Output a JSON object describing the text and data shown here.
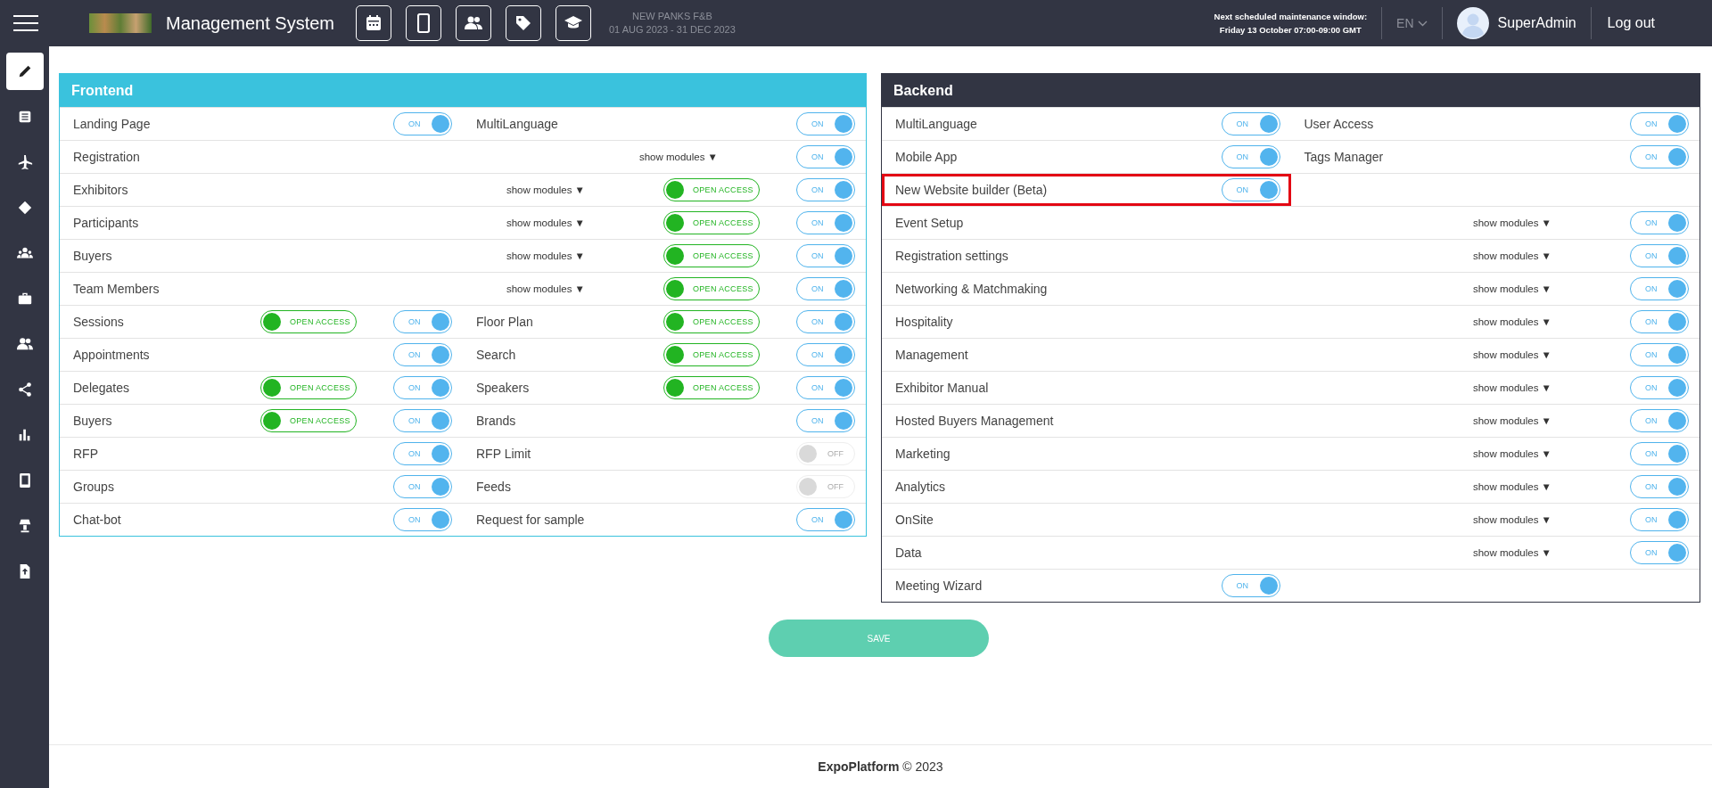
{
  "header": {
    "title": "Management System",
    "event_name": "NEW PANKS F&B",
    "event_dates": "01 AUG 2023 - 31 DEC 2023",
    "maintenance_title": "Next scheduled maintenance window:",
    "maintenance_time": "Friday 13 October 07:00-09:00 GMT",
    "language": "EN",
    "user": "SuperAdmin",
    "logout": "Log out"
  },
  "sidebar": {
    "items": [
      {
        "selected": true
      },
      {
        "selected": false
      },
      {
        "selected": false
      },
      {
        "selected": false
      },
      {
        "selected": false
      },
      {
        "selected": false
      },
      {
        "selected": false
      },
      {
        "selected": false
      },
      {
        "selected": false
      },
      {
        "selected": false
      },
      {
        "selected": false
      },
      {
        "selected": false
      }
    ]
  },
  "frontend": {
    "title": "Frontend",
    "rows": [
      {
        "kind": "split",
        "cells": [
          {
            "label": "Landing Page",
            "toggle": {
              "label": "ON",
              "on": true
            }
          },
          {
            "label": "MultiLanguage",
            "toggle": {
              "label": "ON",
              "on": true
            }
          }
        ]
      },
      {
        "kind": "full",
        "cells": [
          {
            "label": "Registration",
            "show_modules": "show modules ▼",
            "toggle": {
              "label": "ON",
              "on": true
            }
          }
        ]
      },
      {
        "kind": "full",
        "cells": [
          {
            "label": "Exhibitors",
            "show_modules": "show modules ▼",
            "open_access": {
              "label": "OPEN ACCESS",
              "on": true
            },
            "toggle": {
              "label": "ON",
              "on": true
            }
          }
        ]
      },
      {
        "kind": "full",
        "cells": [
          {
            "label": "Participants",
            "show_modules": "show modules ▼",
            "open_access": {
              "label": "OPEN ACCESS",
              "on": true
            },
            "toggle": {
              "label": "ON",
              "on": true
            }
          }
        ]
      },
      {
        "kind": "full",
        "cells": [
          {
            "label": "Buyers",
            "show_modules": "show modules ▼",
            "open_access": {
              "label": "OPEN ACCESS",
              "on": true
            },
            "toggle": {
              "label": "ON",
              "on": true
            }
          }
        ]
      },
      {
        "kind": "full",
        "cells": [
          {
            "label": "Team Members",
            "show_modules": "show modules ▼",
            "open_access": {
              "label": "OPEN ACCESS",
              "on": true
            },
            "toggle": {
              "label": "ON",
              "on": true
            }
          }
        ]
      },
      {
        "kind": "split",
        "cells": [
          {
            "label": "Sessions",
            "open_access": {
              "label": "OPEN ACCESS",
              "on": true
            },
            "toggle": {
              "label": "ON",
              "on": true
            }
          },
          {
            "label": "Floor Plan",
            "open_access": {
              "label": "OPEN ACCESS",
              "on": true
            },
            "toggle": {
              "label": "ON",
              "on": true
            }
          }
        ]
      },
      {
        "kind": "split",
        "cells": [
          {
            "label": "Appointments",
            "toggle": {
              "label": "ON",
              "on": true
            }
          },
          {
            "label": "Search",
            "open_access": {
              "label": "OPEN ACCESS",
              "on": true
            },
            "toggle": {
              "label": "ON",
              "on": true
            }
          }
        ]
      },
      {
        "kind": "split",
        "cells": [
          {
            "label": "Delegates",
            "open_access": {
              "label": "OPEN ACCESS",
              "on": true
            },
            "toggle": {
              "label": "ON",
              "on": true
            }
          },
          {
            "label": "Speakers",
            "open_access": {
              "label": "OPEN ACCESS",
              "on": true
            },
            "toggle": {
              "label": "ON",
              "on": true
            }
          }
        ]
      },
      {
        "kind": "split",
        "cells": [
          {
            "label": "Buyers",
            "open_access": {
              "label": "OPEN ACCESS",
              "on": true
            },
            "toggle": {
              "label": "ON",
              "on": true
            }
          },
          {
            "label": "Brands",
            "toggle": {
              "label": "ON",
              "on": true
            }
          }
        ]
      },
      {
        "kind": "split",
        "cells": [
          {
            "label": "RFP",
            "toggle": {
              "label": "ON",
              "on": true
            }
          },
          {
            "label": "RFP Limit",
            "toggle": {
              "label": "OFF",
              "on": false
            }
          }
        ]
      },
      {
        "kind": "split",
        "cells": [
          {
            "label": "Groups",
            "toggle": {
              "label": "ON",
              "on": true
            }
          },
          {
            "label": "Feeds",
            "toggle": {
              "label": "OFF",
              "on": false
            }
          }
        ]
      },
      {
        "kind": "split",
        "cells": [
          {
            "label": "Chat-bot",
            "toggle": {
              "label": "ON",
              "on": true
            }
          },
          {
            "label": "Request for sample",
            "toggle": {
              "label": "ON",
              "on": true
            }
          }
        ]
      }
    ]
  },
  "backend": {
    "title": "Backend",
    "rows": [
      {
        "kind": "split",
        "cells": [
          {
            "label": "MultiLanguage",
            "toggle": {
              "label": "ON",
              "on": true
            }
          },
          {
            "label": "User Access",
            "toggle": {
              "label": "ON",
              "on": true
            }
          }
        ]
      },
      {
        "kind": "split",
        "cells": [
          {
            "label": "Mobile App",
            "toggle": {
              "label": "ON",
              "on": true
            }
          },
          {
            "label": "Tags Manager",
            "toggle": {
              "label": "ON",
              "on": true
            }
          }
        ]
      },
      {
        "kind": "split",
        "cells": [
          {
            "label": "New Website builder (Beta)",
            "highlighted": true,
            "toggle": {
              "label": "ON",
              "on": true
            }
          }
        ]
      },
      {
        "kind": "full",
        "cells": [
          {
            "label": "Event Setup",
            "show_modules": "show modules ▼",
            "toggle": {
              "label": "ON",
              "on": true
            }
          }
        ]
      },
      {
        "kind": "full",
        "cells": [
          {
            "label": "Registration settings",
            "show_modules": "show modules ▼",
            "toggle": {
              "label": "ON",
              "on": true
            }
          }
        ]
      },
      {
        "kind": "full",
        "cells": [
          {
            "label": "Networking & Matchmaking",
            "show_modules": "show modules ▼",
            "toggle": {
              "label": "ON",
              "on": true
            }
          }
        ]
      },
      {
        "kind": "full",
        "cells": [
          {
            "label": "Hospitality",
            "show_modules": "show modules ▼",
            "toggle": {
              "label": "ON",
              "on": true
            }
          }
        ]
      },
      {
        "kind": "full",
        "cells": [
          {
            "label": "Management",
            "show_modules": "show modules ▼",
            "toggle": {
              "label": "ON",
              "on": true
            }
          }
        ]
      },
      {
        "kind": "full",
        "cells": [
          {
            "label": "Exhibitor Manual",
            "show_modules": "show modules ▼",
            "toggle": {
              "label": "ON",
              "on": true
            }
          }
        ]
      },
      {
        "kind": "full",
        "cells": [
          {
            "label": "Hosted Buyers Management",
            "show_modules": "show modules ▼",
            "toggle": {
              "label": "ON",
              "on": true
            }
          }
        ]
      },
      {
        "kind": "full",
        "cells": [
          {
            "label": "Marketing",
            "show_modules": "show modules ▼",
            "toggle": {
              "label": "ON",
              "on": true
            }
          }
        ]
      },
      {
        "kind": "full",
        "cells": [
          {
            "label": "Analytics",
            "show_modules": "show modules ▼",
            "toggle": {
              "label": "ON",
              "on": true
            }
          }
        ]
      },
      {
        "kind": "full",
        "cells": [
          {
            "label": "OnSite",
            "show_modules": "show modules ▼",
            "toggle": {
              "label": "ON",
              "on": true
            }
          }
        ]
      },
      {
        "kind": "full",
        "cells": [
          {
            "label": "Data",
            "show_modules": "show modules ▼",
            "toggle": {
              "label": "ON",
              "on": true
            }
          }
        ]
      },
      {
        "kind": "split",
        "cells": [
          {
            "label": "Meeting Wizard",
            "toggle": {
              "label": "ON",
              "on": true
            }
          }
        ]
      }
    ]
  },
  "save_button": "SAVE",
  "footer": "**ExpoPlatform** © 2023"
}
